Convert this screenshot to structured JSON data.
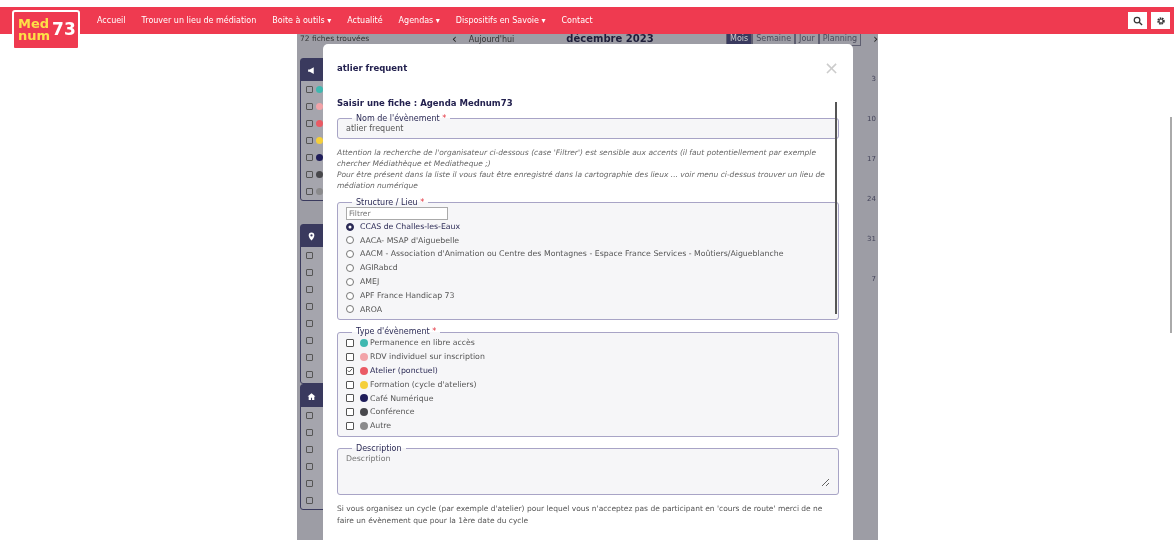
{
  "navbar": {
    "logo": {
      "line1": "Med",
      "line2": "num",
      "number": "73"
    },
    "items": [
      {
        "label": "Accueil"
      },
      {
        "label": "Trouver un lieu de médiation"
      },
      {
        "label": "Boite à outils",
        "caret": "▾"
      },
      {
        "label": "Actualité"
      },
      {
        "label": "Agendas",
        "caret": "▾"
      },
      {
        "label": "Dispositifs en Savoie",
        "caret": "▾"
      },
      {
        "label": "Contact"
      }
    ]
  },
  "background": {
    "results": "72 fiches trouvées",
    "calendar": {
      "prev": "‹",
      "today": "Aujourd'hui",
      "next": "›",
      "month": "décembre 2023",
      "views": [
        {
          "label": "Mois",
          "selected": true
        },
        {
          "label": "Semaine",
          "selected": false
        },
        {
          "label": "Jour",
          "selected": false
        },
        {
          "label": "Planning",
          "selected": false
        }
      ],
      "week_numbers": [
        "3",
        "10",
        "17",
        "24",
        "31",
        "7"
      ]
    },
    "panels": [
      {
        "kind": "types",
        "rows": [
          {
            "checked": false,
            "color": "#3fb8b0"
          },
          {
            "checked": false,
            "color": "#f2a3a8"
          },
          {
            "checked": false,
            "color": "#ea5a64"
          },
          {
            "checked": false,
            "color": "#f5cf3a"
          },
          {
            "checked": false,
            "color": "#1f1d5a"
          },
          {
            "checked": false,
            "color": "#48484c"
          },
          {
            "checked": false,
            "color": "#8a8a8c"
          }
        ]
      },
      {
        "kind": "places",
        "rows": [
          {
            "checked": false
          },
          {
            "checked": false
          },
          {
            "checked": false
          },
          {
            "checked": false
          },
          {
            "checked": false
          },
          {
            "checked": false
          },
          {
            "checked": false
          },
          {
            "checked": false
          }
        ]
      },
      {
        "kind": "structures",
        "rows": [
          {
            "checked": false
          },
          {
            "checked": false
          },
          {
            "checked": false
          },
          {
            "checked": false
          },
          {
            "checked": false
          },
          {
            "checked": false
          }
        ]
      }
    ]
  },
  "modal": {
    "title": "atlier frequent",
    "close": "×",
    "form_title": "Saisir une fiche :  Agenda Mednum73",
    "name_field": {
      "legend": "Nom de l'évènement",
      "required_mark": "*",
      "value": "atlier frequent"
    },
    "notice": [
      "Attention la recherche de l'organisateur ci-dessous (case 'Filtrer') est sensible aux accents (il faut potentiellement par exemple chercher Médiathèque et Mediatheque ;)",
      "Pour être présent dans la liste il vous faut être enregistré dans la cartographie des lieux ... voir menu ci-dessus trouver un lieu de médiation numérique"
    ],
    "structure": {
      "legend": "Structure / Lieu",
      "required_mark": "*",
      "filter_placeholder": "Filtrer",
      "options": [
        {
          "label": "CCAS de Challes-les-Eaux",
          "selected": true
        },
        {
          "label": "AACA- MSAP d'Aiguebelle",
          "selected": false
        },
        {
          "label": "AACM - Association d'Animation ou Centre des Montagnes - Espace France Services - Moûtiers/Aigueblanche",
          "selected": false
        },
        {
          "label": "AGIRabcd",
          "selected": false
        },
        {
          "label": "AMEJ",
          "selected": false
        },
        {
          "label": "APF France Handicap 73",
          "selected": false
        },
        {
          "label": "AROA",
          "selected": false
        }
      ]
    },
    "event_type": {
      "legend": "Type d'évènement",
      "required_mark": "*",
      "options": [
        {
          "label": "Permanence en libre accès",
          "color": "#3fb8b0",
          "checked": false
        },
        {
          "label": "RDV individuel sur inscription",
          "color": "#f2a3a8",
          "checked": false
        },
        {
          "label": "Atelier (ponctuel)",
          "color": "#ea5a64",
          "checked": true
        },
        {
          "label": "Formation (cycle d'ateliers)",
          "color": "#f5cf3a",
          "checked": false
        },
        {
          "label": "Café Numérique",
          "color": "#1f1d5a",
          "checked": false
        },
        {
          "label": "Conférence",
          "color": "#48484c",
          "checked": false
        },
        {
          "label": "Autre",
          "color": "#8a8a8c",
          "checked": false
        }
      ]
    },
    "description": {
      "legend": "Description",
      "placeholder": "Description"
    },
    "cycle_note": "Si vous organisez un cycle (par exemple d'atelier) pour lequel vous n'acceptez pas de participant en 'cours de route' merci de ne faire un évènement que pour la 1ère date du cycle"
  }
}
